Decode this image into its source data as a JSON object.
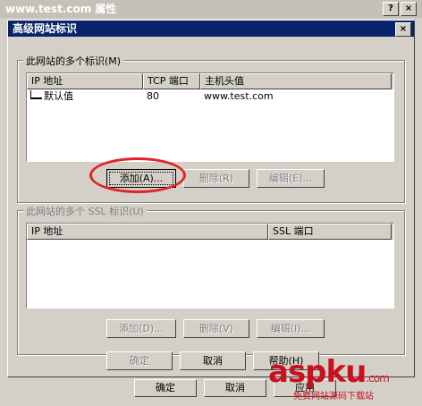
{
  "background_window": {
    "title": "www.test.com 属性",
    "help_button": "?",
    "close_button": "×",
    "bottom_buttons": [
      "确定",
      "取消",
      "应用"
    ]
  },
  "dialog": {
    "title": "高级网站标识",
    "close_button": "×",
    "multi_identity": {
      "legend": "此网站的多个标识(M)",
      "columns": [
        "IP 地址",
        "TCP 端口",
        "主机头值"
      ],
      "rows": [
        {
          "ip": "默认值",
          "port": "80",
          "host": "www.test.com"
        }
      ],
      "buttons": {
        "add": "添加(A)...",
        "remove": "删除(R)",
        "edit": "编辑(E)..."
      }
    },
    "ssl_identity": {
      "legend": "此网站的多个 SSL 标识(U)",
      "columns": [
        "IP 地址",
        "SSL 端口"
      ],
      "buttons": {
        "add": "添加(D)...",
        "remove": "删除(V)",
        "edit": "编辑(I)..."
      }
    },
    "footer_buttons": {
      "ok": "确定",
      "cancel": "取消",
      "help": "帮助(H)"
    }
  },
  "watermark": {
    "brand": "aspku",
    "domain_suffix": ".com",
    "tagline": "免费网站源码下载站"
  },
  "colors": {
    "title_active": "#0a246a",
    "face": "#d4d0c8",
    "highlight_circle": "#e0242a",
    "watermark": "#c8101e"
  }
}
